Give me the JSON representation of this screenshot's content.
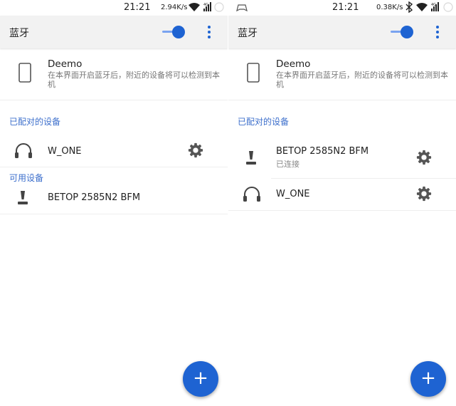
{
  "left": {
    "status": {
      "time": "21:21",
      "speed": "2.94K/s",
      "network": "4G"
    },
    "appbar": {
      "title": "蓝牙"
    },
    "device": {
      "name": "Deemo",
      "description": "在本界面开启蓝牙后，附近的设备将可以检测到本机"
    },
    "paired_header": "已配对的设备",
    "paired": [
      {
        "name": "W_ONE",
        "icon": "headphones-icon"
      }
    ],
    "available_header": "可用设备",
    "available": [
      {
        "name": "BETOP 2585N2 BFM",
        "icon": "joystick-icon"
      }
    ],
    "fab": "+"
  },
  "right": {
    "status": {
      "time": "21:21",
      "speed": "0.38K/s",
      "network": "4G"
    },
    "appbar": {
      "title": "蓝牙"
    },
    "device": {
      "name": "Deemo",
      "description": "在本界面开启蓝牙后，附近的设备将可以检测到本机"
    },
    "paired_header": "已配对的设备",
    "paired": [
      {
        "name": "BETOP 2585N2 BFM",
        "status": "已连接",
        "icon": "joystick-icon"
      },
      {
        "name": "W_ONE",
        "icon": "headphones-icon"
      }
    ],
    "fab": "+"
  },
  "colors": {
    "accent": "#1e63d2",
    "section": "#3d6fcc"
  }
}
